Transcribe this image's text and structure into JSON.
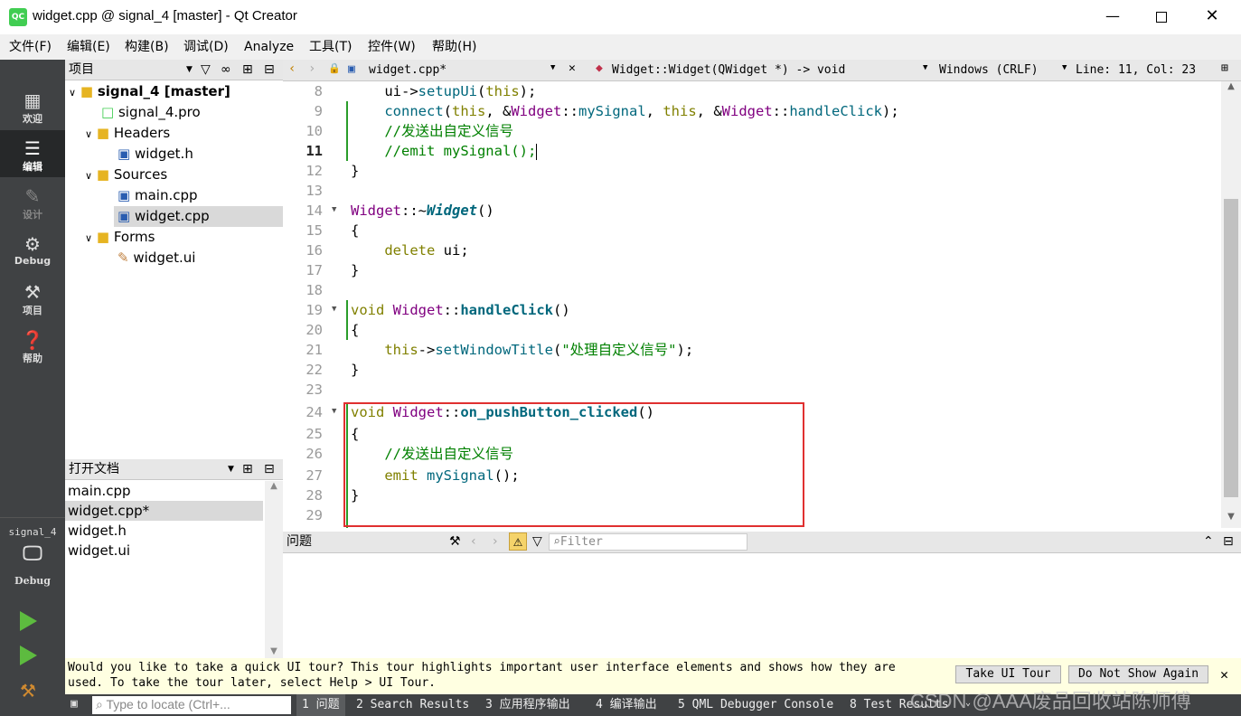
{
  "window": {
    "title": "widget.cpp @ signal_4 [master] - Qt Creator",
    "app_icon": "QC"
  },
  "menu": [
    "文件(F)",
    "编辑(E)",
    "构建(B)",
    "调试(D)",
    "Analyze",
    "工具(T)",
    "控件(W)",
    "帮助(H)"
  ],
  "modes": {
    "welcome": "欢迎",
    "edit": "编辑",
    "design": "设计",
    "debug": "Debug",
    "projects": "项目",
    "help": "帮助"
  },
  "kit": {
    "name": "signal_4",
    "config": "Debug"
  },
  "project_pane": {
    "title": "项目"
  },
  "tree": {
    "root": "signal_4 [master]",
    "pro": "signal_4.pro",
    "headers": "Headers",
    "widget_h": "widget.h",
    "sources": "Sources",
    "main_cpp": "main.cpp",
    "widget_cpp": "widget.cpp",
    "forms": "Forms",
    "widget_ui": "widget.ui"
  },
  "open_docs": {
    "title": "打开文档",
    "items": [
      "main.cpp",
      "widget.cpp*",
      "widget.h",
      "widget.ui"
    ]
  },
  "editor_toolbar": {
    "file": "widget.cpp*",
    "symbol": "Widget::Widget(QWidget *) -> void",
    "line_ending": "Windows (CRLF)",
    "position": "Line: 11, Col: 23"
  },
  "line_numbers": [
    "8",
    "9",
    "10",
    "11",
    "12",
    "13",
    "14",
    "15",
    "16",
    "17",
    "18",
    "19",
    "20",
    "21",
    "22",
    "23",
    "24",
    "25",
    "26",
    "27",
    "28",
    "29"
  ],
  "code": {
    "l8": {
      "a": "ui->",
      "b": "setupUi",
      "c": "(",
      "d": "this",
      "e": ");"
    },
    "l9": {
      "a": "connect",
      "b": "(",
      "c": "this",
      "d": ", &",
      "e": "Widget",
      "f": "::",
      "g": "mySignal",
      "h": ", ",
      "i": "this",
      "j": ", &",
      "k": "Widget",
      "l": "::",
      "m": "handleClick",
      "n": ");"
    },
    "l10": "//发送出自定义信号",
    "l11": "//emit mySignal();",
    "l14": {
      "a": "Widget",
      "b": "::~",
      "c": "Widget",
      "d": "()"
    },
    "l16": {
      "a": "delete",
      "b": " ui;"
    },
    "l19": {
      "a": "void",
      "b": "Widget",
      "c": "::",
      "d": "handleClick",
      "e": "()"
    },
    "l21": {
      "a": "this",
      "b": "->",
      "c": "setWindowTitle",
      "d": "(",
      "e": "\"处理自定义信号\"",
      "f": ");"
    },
    "l24": {
      "a": "void",
      "b": "Widget",
      "c": "::",
      "d": "on_pushButton_clicked",
      "e": "()"
    },
    "l26": "//发送出自定义信号",
    "l27": {
      "a": "emit",
      "b": "mySignal",
      "c": "();"
    },
    "open_brace": "{",
    "close_brace": "}"
  },
  "issues": {
    "title": "问题",
    "filter_placeholder": "Filter"
  },
  "tour": {
    "message_1": "Would you like to take a quick UI tour? This tour highlights important user interface elements and shows how they are",
    "message_2": "used. To take the tour later, select Help > UI Tour.",
    "take_tour": "Take UI Tour",
    "dont_show": "Do Not Show Again"
  },
  "statusbar": {
    "locate_placeholder": "Type to locate (Ctrl+...",
    "tabs": [
      "1 问题",
      "2 Search Results",
      "3 应用程序输出",
      "4 编译输出",
      "5 QML Debugger Console",
      "8 Test Results"
    ]
  },
  "watermark": "CSDN @AAA废品回收站陈师傅",
  "colors": {
    "keyword": "#808000",
    "type": "#800080",
    "function": "#00677c",
    "comment": "#008000",
    "highlight_box": "#e03030",
    "sidebar": "#404244"
  }
}
